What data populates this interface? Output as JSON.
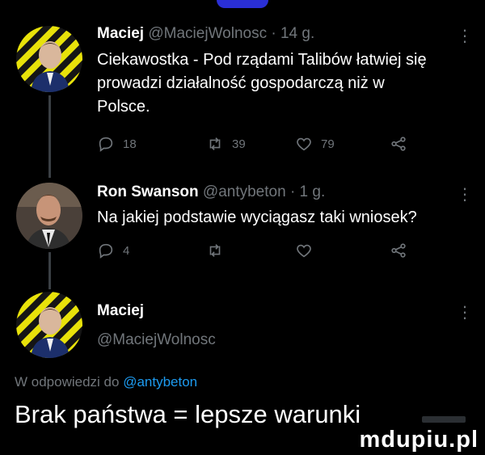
{
  "tweets": [
    {
      "name": "Maciej",
      "handle": "@MaciejWolnosc",
      "dot": "·",
      "time": "14 g.",
      "more": "⋮",
      "text": "Ciekawostka - Pod rządami Talibów łatwiej się\nprowadzi działalność gospodarczą niż w\nPolsce.",
      "replies": "18",
      "retweets": "39",
      "likes": "79"
    },
    {
      "name": "Ron Swanson",
      "handle": "@antybeton",
      "dot": "·",
      "time": "1 g.",
      "more": "⋮",
      "text": "Na jakiej podstawie wyciągasz taki wniosek?",
      "replies": "4",
      "retweets": "",
      "likes": ""
    }
  ],
  "main_tweet": {
    "name": "Maciej",
    "handle": "@MaciejWolnosc",
    "more": "⋮",
    "reply_prefix": "W odpowiedzi do ",
    "reply_mention": "@antybeton",
    "text": "Brak państwa = lepsze warunki"
  },
  "watermark": "mdupiu.pl",
  "colors": {
    "background": "#000000",
    "muted": "#71767b",
    "link": "#1d9bf0",
    "text": "#ffffff"
  },
  "icons": [
    "reply-icon",
    "retweet-icon",
    "like-icon",
    "share-icon",
    "more-icon"
  ]
}
